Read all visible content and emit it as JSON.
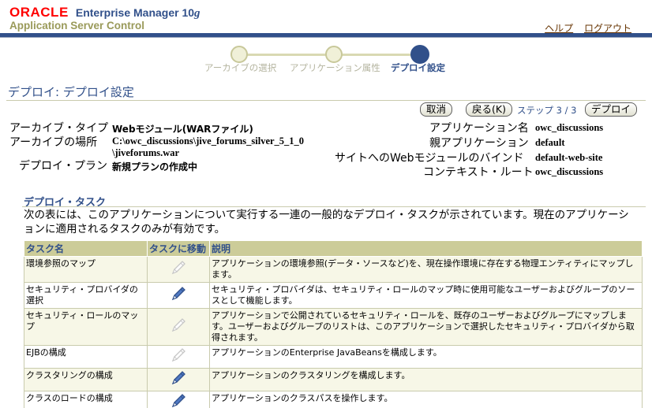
{
  "header": {
    "oracle": "ORACLE",
    "product": "Enterprise Manager 10",
    "version": "g",
    "subtitle": "Application Server Control",
    "links": {
      "help": "ヘルプ",
      "logout": "ログアウト"
    }
  },
  "train": {
    "steps": [
      {
        "label": "アーカイブの選択",
        "state": "done"
      },
      {
        "label": "アプリケーション属性",
        "state": "done"
      },
      {
        "label": "デプロイ設定",
        "state": "current"
      }
    ]
  },
  "page": {
    "title": "デプロイ: デプロイ設定"
  },
  "buttons": {
    "cancel": "取消",
    "back": "戻る(K)",
    "step": "ステップ 3 / 3",
    "deploy": "デプロイ"
  },
  "properties": {
    "archive_type_label": "アーカイブ・タイプ",
    "archive_type_value": "Webモジュール(WARファイル)",
    "archive_location_label": "アーカイブの場所",
    "archive_location_value_line1": "C:\\owc_discussions\\jive_forums_silver_5_1_0",
    "archive_location_value_line2": "\\jiveforums.war",
    "deploy_plan_label": "デプロイ・プラン",
    "deploy_plan_value": "新規プランの作成中",
    "app_name_label": "アプリケーション名",
    "app_name_value": "owc_discussions",
    "parent_app_label": "親アプリケーション",
    "parent_app_value": "default",
    "web_binding_label": "サイトへのWebモジュールのバインド",
    "web_binding_value": "default-web-site",
    "context_root_label": "コンテキスト・ルート",
    "context_root_value": "owc_discussions"
  },
  "tasks": {
    "title": "デプロイ・タスク",
    "description": "次の表には、このアプリケーションについて実行する一連の一般的なデプロイ・タスクが示されています。現在のアプリケーションに適用されるタスクのみが有効です。",
    "columns": [
      "タスク名",
      "タスクに移動",
      "説明"
    ],
    "rows": [
      {
        "name": "環境参照のマップ",
        "enabled": false,
        "desc": "アプリケーションの環境参照(データ・ソースなど)を、現在操作環境に存在する物理エンティティにマップします。"
      },
      {
        "name": "セキュリティ・プロバイダの選択",
        "enabled": true,
        "desc": "セキュリティ・プロバイダは、セキュリティ・ロールのマップ時に使用可能なユーザーおよびグループのソースとして機能します。"
      },
      {
        "name": "セキュリティ・ロールのマップ",
        "enabled": false,
        "desc": "アプリケーションで公開されているセキュリティ・ロールを、既存のユーザーおよびグループにマップします。ユーザーおよびグループのリストは、このアプリケーションで選択したセキュリティ・プロバイダから取得されます。"
      },
      {
        "name": "EJBの構成",
        "enabled": false,
        "desc": "アプリケーションのEnterprise JavaBeansを構成します。"
      },
      {
        "name": "クラスタリングの構成",
        "enabled": true,
        "desc": "アプリケーションのクラスタリングを構成します。"
      },
      {
        "name": "クラスのロードの構成",
        "enabled": true,
        "desc": "アプリケーションのクラスパスを操作します。"
      }
    ]
  },
  "colors": {
    "brand_blue": "#31508a",
    "oracle_red": "#ff0000",
    "table_header": "#cccc99",
    "link": "#663300"
  }
}
